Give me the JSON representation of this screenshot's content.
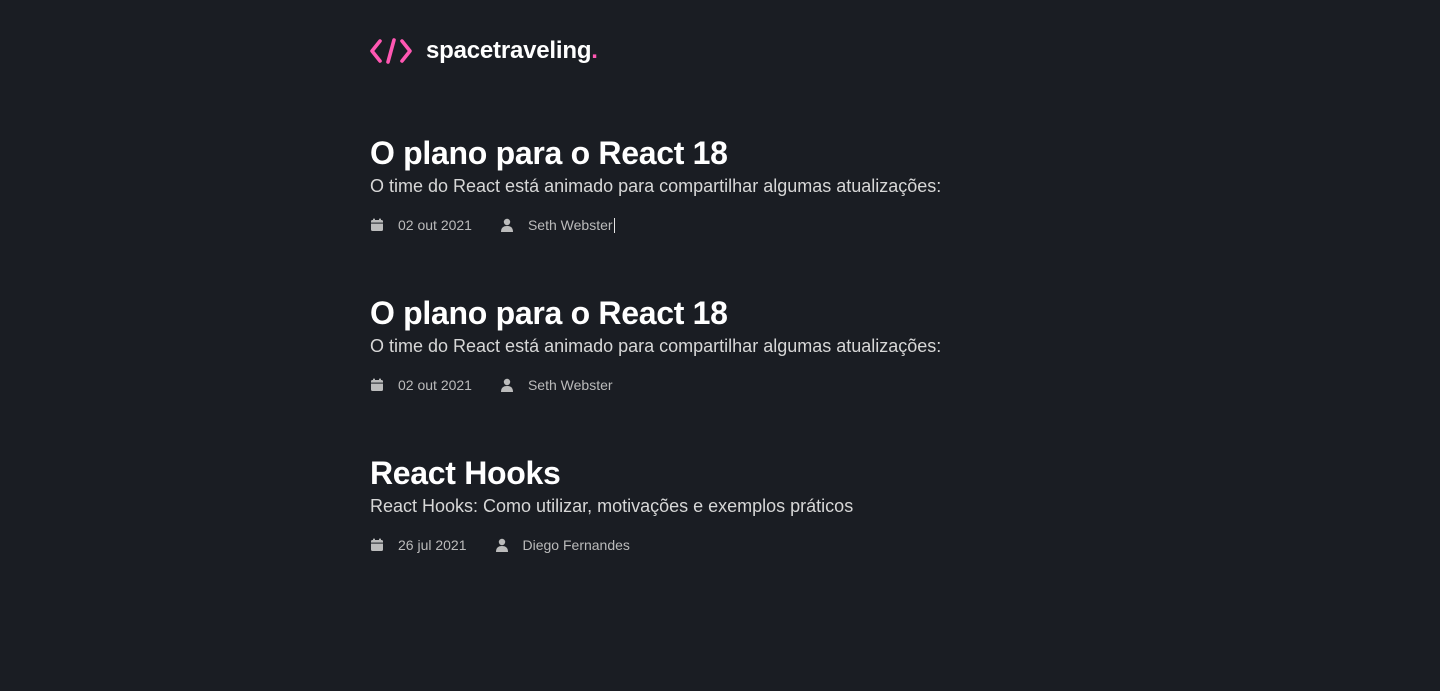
{
  "brand": {
    "name": "spacetraveling",
    "dot": ".",
    "accent_color": "#ff57b2",
    "icon": "code-icon"
  },
  "posts": [
    {
      "title": "O plano para o React 18",
      "subtitle": "O time do React está animado para compartilhar algumas atualizações:",
      "date": "02 out 2021",
      "author": "Seth Webster"
    },
    {
      "title": "O plano para o React 18",
      "subtitle": "O time do React está animado para compartilhar algumas atualizações:",
      "date": "02 out 2021",
      "author": "Seth Webster"
    },
    {
      "title": "React Hooks",
      "subtitle": "React Hooks: Como utilizar, motivações e exemplos práticos",
      "date": "26 jul 2021",
      "author": "Diego Fernandes"
    }
  ],
  "icons": {
    "date": "calendar-icon",
    "author": "user-icon"
  },
  "colors": {
    "background": "#1a1d23",
    "title": "#ffffff",
    "body": "#d7d7d7",
    "meta": "#bbbbbb"
  }
}
